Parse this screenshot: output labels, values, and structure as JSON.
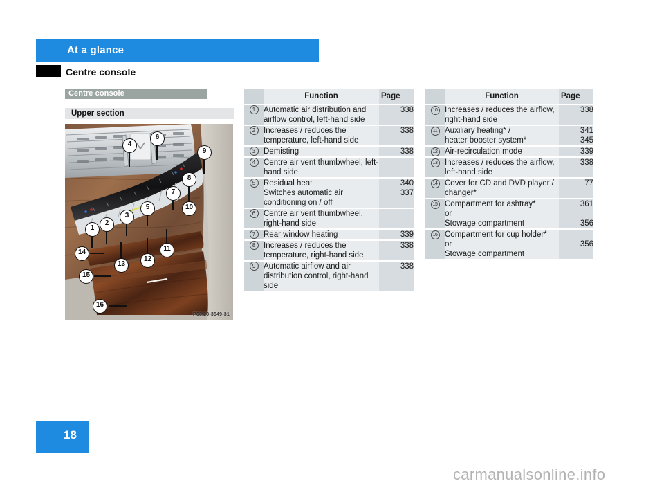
{
  "header": {
    "banner_title": "At a glance",
    "section_title": "Centre console"
  },
  "left_column": {
    "primary_bar": "Centre console",
    "secondary_bar": "Upper section",
    "figure_caption": "P68.20-3549-31",
    "figure_callouts": [
      "1",
      "2",
      "3",
      "4",
      "5",
      "6",
      "7",
      "8",
      "9",
      "10",
      "11",
      "12",
      "13",
      "14",
      "15",
      "16"
    ]
  },
  "table_left": {
    "headers": {
      "num": "",
      "function": "Function",
      "page": "Page"
    },
    "rows": [
      {
        "num": "1",
        "function": "Automatic air distribution and airflow control, left-hand side",
        "page": "338"
      },
      {
        "num": "2",
        "function": "Increases / reduces the temperature, left-hand side",
        "page": "338"
      },
      {
        "num": "3",
        "function": "Demisting",
        "page": "338"
      },
      {
        "num": "4",
        "function": "Centre air vent thumbwheel, left-hand side",
        "page": ""
      },
      {
        "num": "5",
        "function": "Residual heat",
        "page": "340",
        "sub": {
          "function": "Switches automatic air conditioning on / off",
          "page": "337"
        }
      },
      {
        "num": "6",
        "function": "Centre air vent thumbwheel, right-hand side",
        "page": ""
      },
      {
        "num": "7",
        "function": "Rear window heating",
        "page": "339"
      },
      {
        "num": "8",
        "function": "Increases / reduces the temperature, right-hand side",
        "page": "338"
      },
      {
        "num": "9",
        "function": "Automatic airflow and air distribution control, right-hand side",
        "page": "338"
      }
    ]
  },
  "table_right": {
    "headers": {
      "num": "",
      "function": "Function",
      "page": "Page"
    },
    "rows": [
      {
        "num": "10",
        "function": "Increases / reduces the airflow, right-hand side",
        "page": "338"
      },
      {
        "num": "11",
        "function": "Auxiliary heating* /",
        "page": "341",
        "sub": {
          "function": "heater booster system*",
          "page": "345"
        }
      },
      {
        "num": "12",
        "function": "Air-recirculation mode",
        "page": "339"
      },
      {
        "num": "13",
        "function": "Increases / reduces the airflow, left-hand side",
        "page": "338"
      },
      {
        "num": "14",
        "function": "Cover for CD and DVD player / changer*",
        "page": "77"
      },
      {
        "num": "15",
        "function": "Compartment for ashtray*",
        "page": "361",
        "or_label": "or",
        "sub": {
          "function": "Stowage compartment",
          "page": "356"
        }
      },
      {
        "num": "16",
        "function": "Compartment for cup holder*",
        "page": "",
        "or_label": "or",
        "sub": {
          "function": "Stowage compartment",
          "page": "356"
        },
        "page_mid": "356"
      }
    ]
  },
  "footer": {
    "page_number": "18",
    "watermark": "carmanualsonline.info"
  },
  "colors": {
    "banner_blue": "#1e8ae0",
    "bar_primary_gray": "#9aa5a2",
    "bar_secondary_gray": "#e3e5e7",
    "table_num_bg": "#ced5d9",
    "table_fn_bg": "#e8ecee",
    "table_pg_bg": "#d6dcdf"
  }
}
